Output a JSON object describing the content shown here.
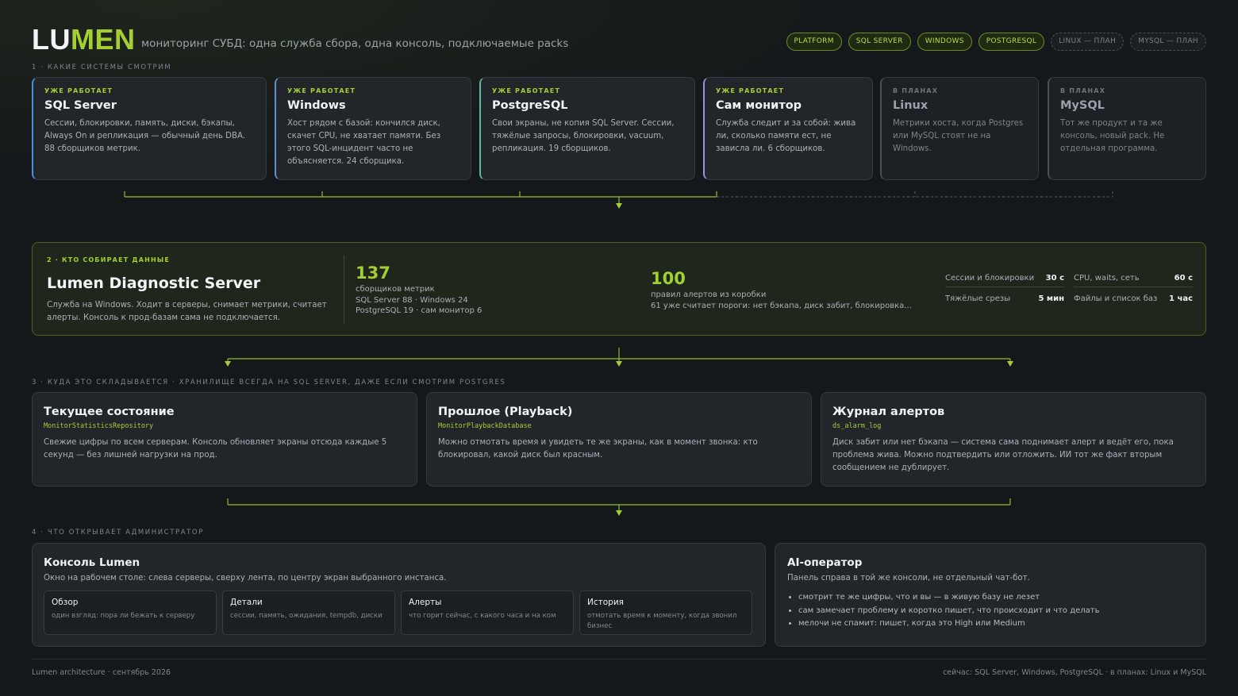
{
  "header": {
    "logo_a": "LU",
    "logo_b": "MEN",
    "tagline": "мониторинг СУБД: одна служба сбора, одна консоль, подключаемые packs",
    "chips": [
      "PLATFORM",
      "SQL SERVER",
      "WINDOWS",
      "POSTGRESQL"
    ],
    "plan_chips": [
      "LINUX — ПЛАН",
      "MYSQL — ПЛАН"
    ]
  },
  "section1": {
    "label": "1 · какие системы смотрим",
    "cards": [
      {
        "tag": "уже работает",
        "title": "SQL Server",
        "desc": "Сессии, блокировки, память, диски, бэкапы, Always On и репликация — обычный день DBA. 88 сборщиков метрик.",
        "accent": "#4a8fe0"
      },
      {
        "tag": "уже работает",
        "title": "Windows",
        "desc": "Хост рядом с базой: кончился диск, скачет CPU, не хватает памяти. Без этого SQL-инцидент часто не объясняется. 24 сборщика.",
        "accent": "#5a93c9"
      },
      {
        "tag": "уже работает",
        "title": "PostgreSQL",
        "desc": "Свои экраны, не копия SQL Server. Сессии, тяжёлые запросы, блокировки, vacuum, репликация. 19 сборщиков.",
        "accent": "#5fb89a"
      },
      {
        "tag": "уже работает",
        "title": "Сам монитор",
        "desc": "Служба следит и за собой: жива ли, сколько памяти ест, не зависла ли. 6 сборщиков.",
        "accent": "#9b8fe0"
      }
    ],
    "plan_cards": [
      {
        "tag": "в планах",
        "title": "Linux",
        "desc": "Метрики хоста, когда Postgres или MySQL стоят не на Windows."
      },
      {
        "tag": "в планах",
        "title": "MySQL",
        "desc": "Тот же продукт и та же консоль, новый pack. Не отдельная программа."
      }
    ]
  },
  "collector": {
    "label": "2 · кто собирает данные",
    "title": "Lumen Diagnostic Server",
    "desc": "Служба на Windows. Ходит в серверы, снимает метрики, считает алерты. Консоль к прод-базам сама не подключается.",
    "collectors_num": "137",
    "collectors_label": "сборщиков метрик",
    "collectors_line1": "SQL Server 88 · Windows 24",
    "collectors_line2": "PostgreSQL 19 · сам монитор 6",
    "alerts_num": "100",
    "alerts_label": "правил алертов из коробки",
    "alerts_line": "61 уже считает пороги: нет бэкапа, диск забит, блокировка...",
    "intervals": [
      {
        "name": "Сессии и блокировки",
        "value": "30 с"
      },
      {
        "name": "CPU, waits, сеть",
        "value": "60 с"
      },
      {
        "name": "Тяжёлые срезы",
        "value": "5 мин"
      },
      {
        "name": "Файлы и список баз",
        "value": "1 час"
      }
    ]
  },
  "storage": {
    "label": "3 · куда это складывается · хранилище всегда на SQL Server, даже если смотрим Postgres",
    "cards": [
      {
        "title": "Текущее состояние",
        "code": "MonitorStatisticsRepository",
        "desc": "Свежие цифры по всем серверам. Консоль обновляет экраны отсюда каждые 5 секунд — без лишней нагрузки на прод."
      },
      {
        "title": "Прошлое (Playback)",
        "code": "MonitorPlaybackDatabase",
        "desc": "Можно отмотать время и увидеть те же экраны, как в момент звонка: кто блокировал, какой диск был красным."
      },
      {
        "title": "Журнал алертов",
        "code": "ds_alarm_log",
        "desc": "Диск забит или нет бэкапа — система сама поднимает алерт и ведёт его, пока проблема жива. Можно подтвердить или отложить. ИИ тот же факт вторым сообщением не дублирует."
      }
    ]
  },
  "admin": {
    "label": "4 · что открывает администратор",
    "console_title": "Консоль Lumen",
    "console_desc": "Окно на рабочем столе: слева серверы, сверху лента, по центру экран выбранного инстанса.",
    "views": [
      {
        "title": "Обзор",
        "desc": "один взгляд: пора ли бежать к серверу"
      },
      {
        "title": "Детали",
        "desc": "сессии, память, ожидания, tempdb, диски"
      },
      {
        "title": "Алерты",
        "desc": "что горит сейчас, с какого часа и на ком"
      },
      {
        "title": "История",
        "desc": "отмотать время к моменту, когда звонил бизнес"
      }
    ],
    "ai_title": "AI-оператор",
    "ai_desc": "Панель справа в той же консоли, не отдельный чат-бот.",
    "ai_points": [
      "смотрит те же цифры, что и вы — в живую базу не лезет",
      "сам замечает проблему и коротко пишет, что происходит и что делать",
      "мелочи не спамит: пишет, когда это High или Medium"
    ]
  },
  "footer": {
    "left": "Lumen architecture · сентябрь 2026",
    "right": "сейчас: SQL Server, Windows, PostgreSQL · в планах: Linux и MySQL"
  },
  "colors": {
    "accent": "#a4cf32",
    "background": "#15181b",
    "card": "#22262b"
  }
}
